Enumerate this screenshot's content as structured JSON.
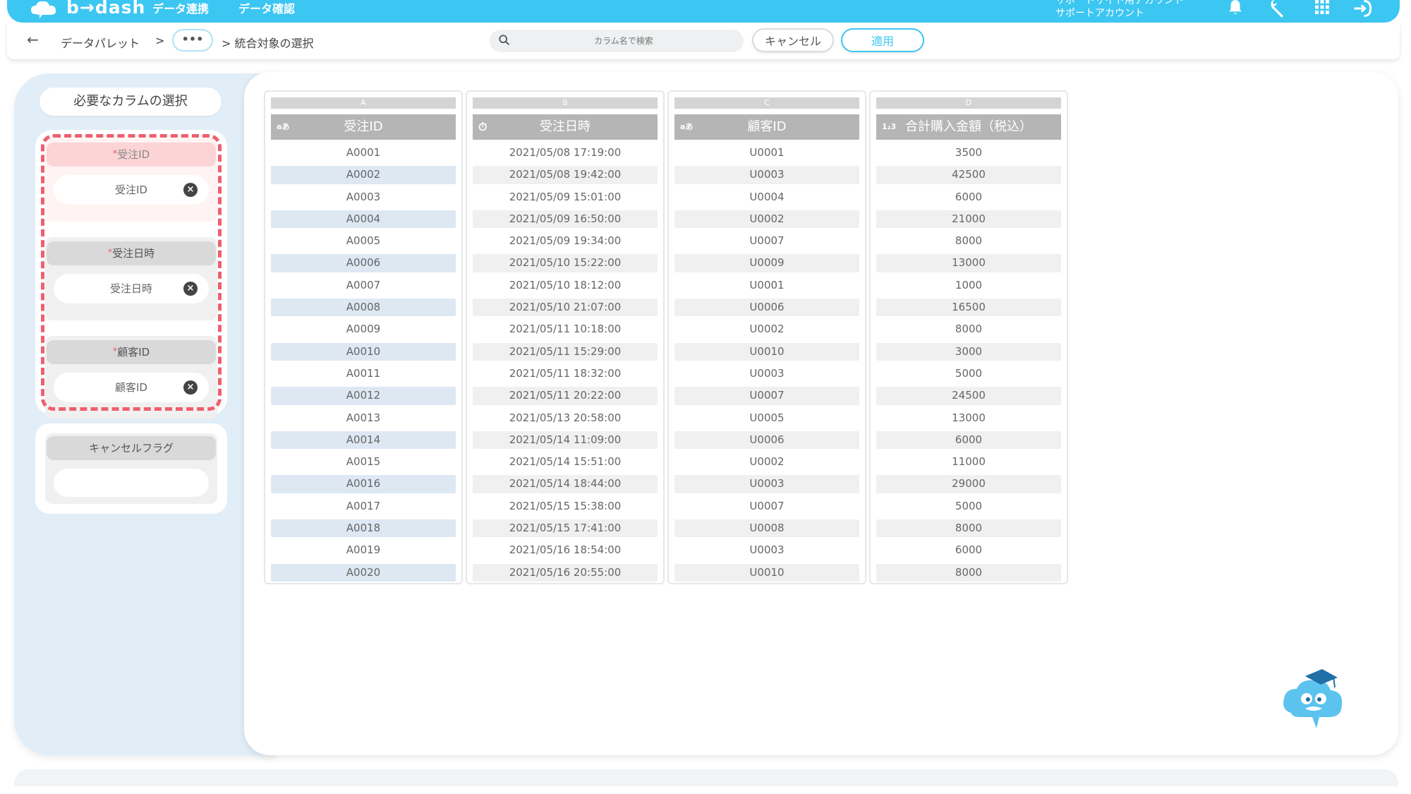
{
  "topbar": {
    "logo_text": "b→dash",
    "nav": [
      "データ連携",
      "データ確認"
    ],
    "account_line1": "サポートサイト用アカウント",
    "account_line2": "サポートアカウント",
    "brand_color": "#3cc6f2"
  },
  "subheader": {
    "breadcrumb_root": "データパレット",
    "breadcrumb_sep": ">",
    "breadcrumb_more": "•••",
    "breadcrumb_current": "> 統合対象の選択",
    "search_placeholder": "カラム名で検索",
    "cancel_label": "キャンセル",
    "apply_label": "適用"
  },
  "panel": {
    "title": "必要なカラムの選択",
    "required_slots": [
      {
        "head": "受注ID",
        "value": "受注ID"
      },
      {
        "head": "受注日時",
        "value": "受注日時"
      },
      {
        "head": "顧客ID",
        "value": "顧客ID"
      }
    ],
    "required_mark": "*",
    "optional_slots": [
      {
        "head": "キャンセルフラグ",
        "value": ""
      }
    ],
    "highlight_color": "#ef5f6e"
  },
  "columns": [
    {
      "letter": "A",
      "name": "受注ID",
      "type_icon": "aあ",
      "values": [
        "A0001",
        "A0002",
        "A0003",
        "A0004",
        "A0005",
        "A0006",
        "A0007",
        "A0008",
        "A0009",
        "A0010",
        "A0011",
        "A0012",
        "A0013",
        "A0014",
        "A0015",
        "A0016",
        "A0017",
        "A0018",
        "A0019",
        "A0020"
      ]
    },
    {
      "letter": "B",
      "name": "受注日時",
      "type_icon": "⏱",
      "values": [
        "2021/05/08 17:19:00",
        "2021/05/08 19:42:00",
        "2021/05/09 15:01:00",
        "2021/05/09 16:50:00",
        "2021/05/09 19:34:00",
        "2021/05/10 15:22:00",
        "2021/05/10 18:12:00",
        "2021/05/10 21:07:00",
        "2021/05/11 10:18:00",
        "2021/05/11 15:29:00",
        "2021/05/11 18:32:00",
        "2021/05/11 20:22:00",
        "2021/05/13 20:58:00",
        "2021/05/14 11:09:00",
        "2021/05/14 15:51:00",
        "2021/05/14 18:44:00",
        "2021/05/15 15:38:00",
        "2021/05/15 17:41:00",
        "2021/05/16 18:54:00",
        "2021/05/16 20:55:00"
      ]
    },
    {
      "letter": "C",
      "name": "顧客ID",
      "type_icon": "aあ",
      "values": [
        "U0001",
        "U0003",
        "U0004",
        "U0002",
        "U0007",
        "U0009",
        "U0001",
        "U0006",
        "U0002",
        "U0010",
        "U0003",
        "U0007",
        "U0005",
        "U0006",
        "U0002",
        "U0003",
        "U0007",
        "U0008",
        "U0003",
        "U0010"
      ]
    },
    {
      "letter": "D",
      "name": "合計購入金額（税込）",
      "type_icon": "1₂3",
      "values": [
        "3500",
        "42500",
        "6000",
        "21000",
        "8000",
        "13000",
        "1000",
        "16500",
        "8000",
        "3000",
        "5000",
        "24500",
        "13000",
        "6000",
        "11000",
        "29000",
        "5000",
        "8000",
        "6000",
        "8000"
      ]
    }
  ]
}
